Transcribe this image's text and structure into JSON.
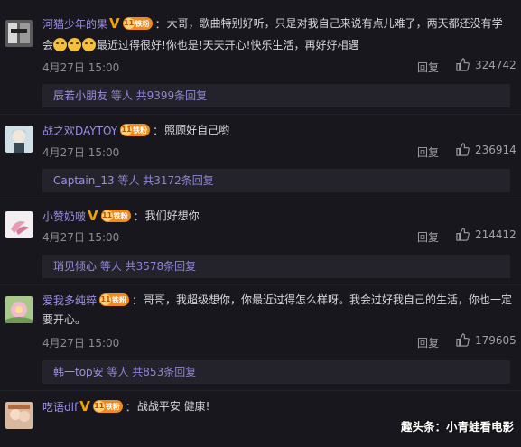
{
  "comments": [
    {
      "username": "河猫少年的果",
      "badge_level": "11",
      "badge_text": "铁粉",
      "text_line1": "大哥，歌曲特别好听，只是对我自己来说有点儿难了，两天都还没有学",
      "text_line2_prefix": "会",
      "text_line2_suffix": "最近过得很好!你也是!天天开心!快乐生活，再好好相遇",
      "emoji_count": 3,
      "date": "4月27日 15:00",
      "reply_label": "回复",
      "likes": "324742",
      "sub_user": "辰若小朋友",
      "sub_rest": " 等人 共9399条回复"
    },
    {
      "username": "战之欢DAYTOY",
      "badge_level": "11",
      "badge_text": "铁粉",
      "text": "照顾好自己哟",
      "date": "4月27日 15:00",
      "reply_label": "回复",
      "likes": "236914",
      "sub_user": "Captain_13",
      "sub_rest": " 等人 共3172条回复"
    },
    {
      "username": "小赞奶啵",
      "badge_level": "11",
      "badge_text": "铁粉",
      "text": "我们好想你",
      "date": "4月27日 15:00",
      "reply_label": "回复",
      "likes": "214412",
      "sub_user": "琑见倾心",
      "sub_rest": " 等人 共3578条回复"
    },
    {
      "username": "爱我多纯粹",
      "badge_level": "11",
      "badge_text": "铁粉",
      "text_line1": "哥哥，我超级想你，你最近过得怎么样呀。我会过好我自己的生活，你也一定",
      "text_line2": "要开心。",
      "date": "4月27日 15:00",
      "reply_label": "回复",
      "likes": "179605",
      "sub_user": "韩一top安",
      "sub_rest": " 等人 共853条回复"
    },
    {
      "username": "呓语dlf",
      "badge_level": "11",
      "badge_text": "铁粉",
      "text": "战战平安 健康!"
    }
  ],
  "watermark": "趣头条：小青蛙看电影",
  "colors": {
    "background": "#18171d",
    "username": "#9b8fe3",
    "vip": "#f0a500",
    "badge": "#f08a1c"
  },
  "icons": [
    "thumbs-up-icon",
    "vip-v-icon",
    "fan-badge-icon",
    "emoji-icon"
  ]
}
